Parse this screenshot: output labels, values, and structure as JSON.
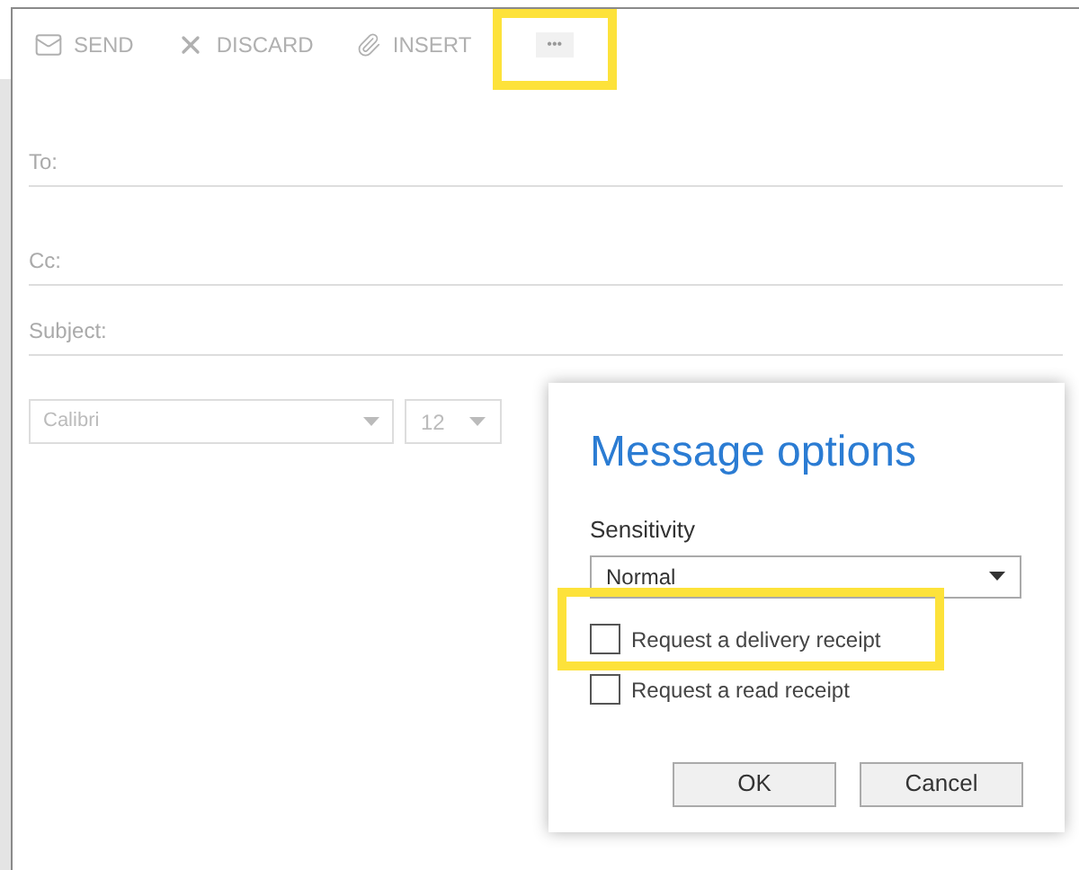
{
  "toolbar": [
    {
      "kind": "send",
      "label": "SEND"
    },
    {
      "kind": "discard",
      "label": "DISCARD"
    },
    {
      "kind": "insert",
      "label": "INSERT"
    },
    {
      "kind": "more",
      "label": "•••"
    }
  ],
  "fields": [
    {
      "label": "To:"
    },
    {
      "label": "Cc:"
    },
    {
      "label": "Subject:"
    }
  ],
  "format_bar": {
    "font": "Calibri",
    "size": "12"
  },
  "dialog": {
    "title": "Message options",
    "sensitivity_label": "Sensitivity",
    "sensitivity": "Normal",
    "options": [
      {
        "label": "Request a delivery receipt",
        "checked": false
      },
      {
        "label": "Request a read receipt",
        "checked": false
      }
    ],
    "buttons": [
      "OK",
      "Cancel"
    ]
  }
}
